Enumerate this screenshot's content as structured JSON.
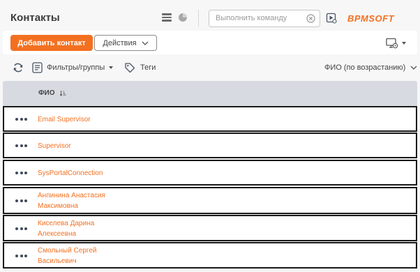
{
  "header": {
    "title": "Контакты",
    "command_placeholder": "Выполнить команду",
    "brand": "BPMSOFT"
  },
  "toolbar": {
    "add_contact_label": "Добавить контакт",
    "actions_label": "Действия"
  },
  "filter_bar": {
    "filters_label": "Фильтры/группы",
    "tags_label": "Теги",
    "sort_label": "ФИО (по возрастанию)"
  },
  "grid": {
    "column_name": "ФИО",
    "rows": [
      {
        "line1": "Email Supervisor",
        "line2": ""
      },
      {
        "line1": "Supervisor",
        "line2": ""
      },
      {
        "line1": "SysPortalConnection",
        "line2": ""
      },
      {
        "line1": "Анпинина Анастасия",
        "line2": "Максимовна"
      },
      {
        "line1": "Киселева Дарина",
        "line2": "Алексеевна"
      },
      {
        "line1": "Смольный Сергей",
        "line2": "Васильевич"
      }
    ]
  },
  "colors": {
    "accent": "#f37021",
    "grid_header": "#d7dbe1",
    "row_menu": "#3f4a5a"
  }
}
